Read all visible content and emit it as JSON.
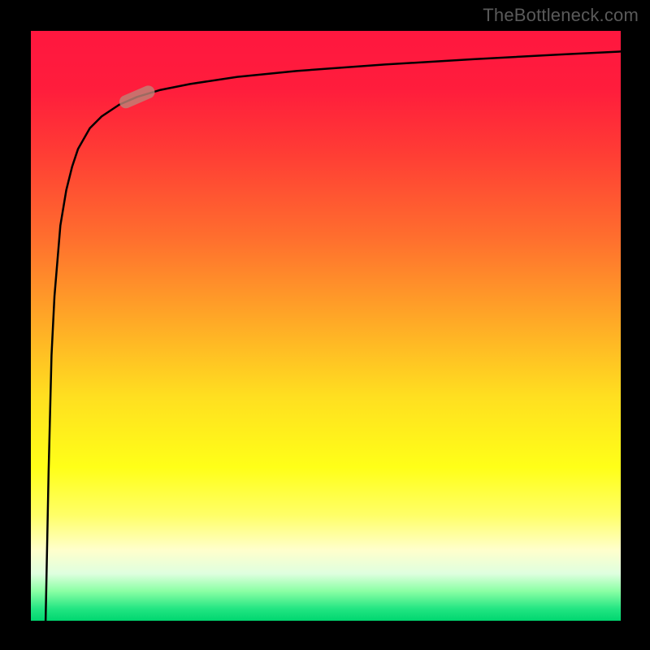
{
  "credit": "TheBottleneck.com",
  "colors": {
    "bg": "#000000",
    "curve": "#000000",
    "marker": "#c08176",
    "gradient_top": "#ff173f",
    "gradient_bottom": "#00d66f"
  },
  "chart_data": {
    "type": "line",
    "title": "",
    "xlabel": "",
    "ylabel": "",
    "xlim": [
      0,
      100
    ],
    "ylim": [
      0,
      100
    ],
    "grid": false,
    "legend": false,
    "marker_at_x": 18,
    "series": [
      {
        "name": "curve",
        "x": [
          2.5,
          3,
          3.5,
          4,
          5,
          6,
          7,
          8,
          10,
          12,
          15,
          18,
          22,
          27,
          35,
          45,
          60,
          75,
          90,
          100
        ],
        "y": [
          0,
          25,
          45,
          55,
          67,
          73,
          77,
          80,
          83.5,
          85.5,
          87.5,
          88.8,
          90.0,
          91.0,
          92.2,
          93.2,
          94.3,
          95.2,
          96.0,
          96.5
        ]
      }
    ]
  }
}
